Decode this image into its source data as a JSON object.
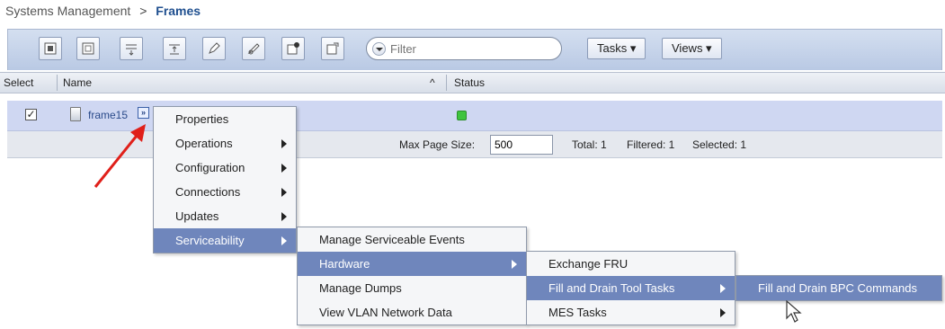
{
  "breadcrumb": {
    "parent": "Systems Management",
    "separator": ">",
    "current": "Frames"
  },
  "toolbar": {
    "icons": [
      "select-all-icon",
      "deselect-all-icon",
      "expand-icon",
      "collapse-icon",
      "edit-icon",
      "clear-icon",
      "config-icon",
      "filter-settings-icon"
    ],
    "filter_placeholder": "Filter",
    "tasks_label": "Tasks ▾",
    "views_label": "Views ▾"
  },
  "table": {
    "headers": {
      "select": "Select",
      "name": "Name",
      "sort_indicator": "^",
      "status": "Status"
    },
    "rows": [
      {
        "checked": true,
        "name": "frame15",
        "status": "ok"
      }
    ],
    "footer": {
      "max_page_label": "Max Page Size:",
      "max_page_value": "500",
      "total": "Total: 1",
      "filtered": "Filtered: 1",
      "selected": "Selected: 1"
    }
  },
  "context_menu": {
    "items": [
      "Properties",
      "Operations",
      "Configuration",
      "Connections",
      "Updates",
      "Serviceability"
    ]
  },
  "serviceability_menu": {
    "items": [
      "Manage Serviceable Events",
      "Hardware",
      "Manage Dumps",
      "View VLAN Network Data"
    ]
  },
  "hardware_menu": {
    "items": [
      "Exchange FRU",
      "Fill and Drain Tool Tasks",
      "MES Tasks"
    ]
  },
  "fill_drain_menu": {
    "items": [
      "Fill and Drain BPC Commands"
    ]
  },
  "colors": {
    "accent": "#6f86bc",
    "status_ok": "#3fc43f",
    "annotation_arrow": "#e0201a",
    "link": "#2a4a8a"
  }
}
